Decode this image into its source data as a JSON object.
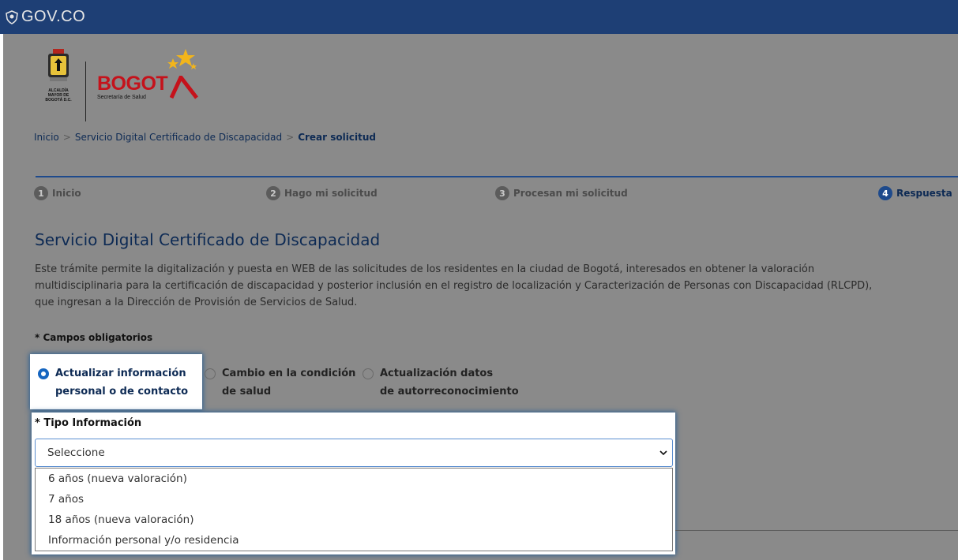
{
  "govbar": {
    "label": "GOV.CO"
  },
  "logos": {
    "alcaldia_text": "ALCALDÍA MAYOR DE BOGOTÁ D.C.",
    "bogota_word": "BOGOT",
    "secretaria": "Secretaría de Salud"
  },
  "breadcrumb": {
    "items": [
      "Inicio",
      "Servicio Digital Certificado de Discapacidad",
      "Crear solicitud"
    ],
    "separator": ">"
  },
  "stepper": {
    "steps": [
      {
        "num": "1",
        "label": "Inicio"
      },
      {
        "num": "2",
        "label": "Hago mi solicitud"
      },
      {
        "num": "3",
        "label": "Procesan mi solicitud"
      },
      {
        "num": "4",
        "label": "Respuesta"
      }
    ],
    "active_step": 4
  },
  "page": {
    "title": "Servicio Digital Certificado de Discapacidad",
    "description": "Este trámite permite la digitalización y puesta en WEB de las solicitudes de los residentes en la ciudad de Bogotá, interesados en obtener la valoración\nmultidisciplinaria para la certificación de discapacidad y posterior inclusión en el registro de localización y Caracterización de Personas con Discapacidad (RLCPD),\nque ingresan a la Dirección de Provisión de Servicios de Salud.",
    "required_note": "* Campos obligatorios"
  },
  "radio_options": [
    {
      "line1": "Actualizar información",
      "line2": "personal o de contacto",
      "checked": true
    },
    {
      "line1": "Cambio en la condición",
      "line2": "de salud",
      "checked": false
    },
    {
      "line1": "Actualización datos",
      "line2": "de autorreconocimiento",
      "checked": false
    }
  ],
  "tipo_informacion": {
    "label": "* Tipo Información",
    "selected": "Seleccione",
    "options": [
      "6 años (nueva valoración)",
      "7 años",
      "18 años (nueva valoración)",
      "Información personal y/o residencia"
    ]
  },
  "colors": {
    "govbar": "#1e3f75",
    "accent": "#1565c0",
    "title": "#0d2a54",
    "bogota_red": "#c5121b",
    "star_yellow": "#f2b51b"
  },
  "icons": [
    "shield-icon",
    "coat-of-arms-icon",
    "stars-icon",
    "chevron-down-icon"
  ]
}
